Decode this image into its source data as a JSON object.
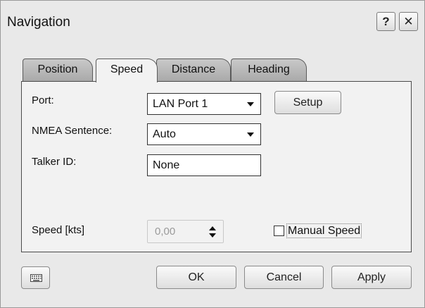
{
  "window": {
    "title": "Navigation",
    "help_label": "?",
    "close_label": "✕"
  },
  "tabs": [
    {
      "label": "Position",
      "active": false
    },
    {
      "label": "Speed",
      "active": true
    },
    {
      "label": "Distance",
      "active": false
    },
    {
      "label": "Heading",
      "active": false
    }
  ],
  "speed_tab": {
    "port_label": "Port:",
    "port_value": "LAN Port 1",
    "setup_label": "Setup",
    "nmea_label": "NMEA Sentence:",
    "nmea_value": "Auto",
    "talker_label": "Talker ID:",
    "talker_value": "None",
    "speed_label": "Speed [kts]",
    "speed_value": "0,00",
    "manual_speed_label": "Manual Speed",
    "manual_speed_checked": false
  },
  "footer": {
    "keyboard_icon": "keyboard-icon",
    "ok_label": "OK",
    "cancel_label": "Cancel",
    "apply_label": "Apply"
  }
}
